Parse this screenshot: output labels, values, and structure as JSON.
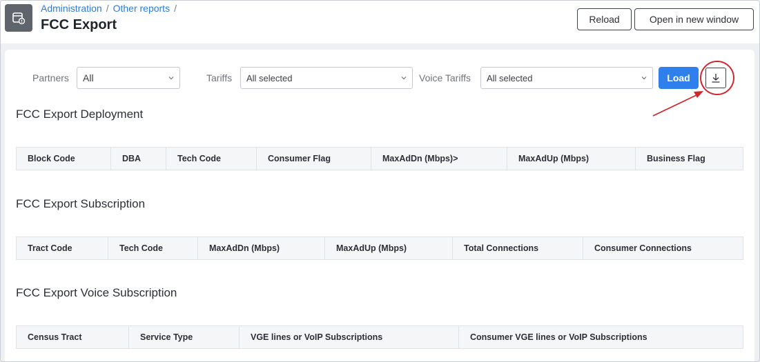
{
  "breadcrumb": {
    "items": [
      "Administration",
      "Other reports"
    ],
    "separator": "/"
  },
  "page_title": "FCC Export",
  "header_buttons": {
    "reload": "Reload",
    "open_new_window": "Open in new window"
  },
  "filters": {
    "partners": {
      "label": "Partners",
      "value": "All"
    },
    "tariffs": {
      "label": "Tariffs",
      "value": "All selected"
    },
    "voice_tariffs": {
      "label": "Voice Tariffs",
      "value": "All selected"
    },
    "load_label": "Load",
    "download_icon": "download-icon"
  },
  "sections": [
    {
      "title": "FCC Export Deployment",
      "columns": [
        "Block Code",
        "DBA",
        "Tech Code",
        "Consumer Flag",
        "MaxAdDn (Mbps)>",
        "MaxAdUp (Mbps)",
        "Business Flag"
      ]
    },
    {
      "title": "FCC Export Subscription",
      "columns": [
        "Tract Code",
        "Tech Code",
        "MaxAdDn (Mbps)",
        "MaxAdUp (Mbps)",
        "Total Connections",
        "Consumer Connections"
      ]
    },
    {
      "title": "FCC Export Voice Subscription",
      "columns": [
        "Census Tract",
        "Service Type",
        "VGE lines or VoIP Subscriptions",
        "Consumer VGE lines or VoIP Subscriptions"
      ]
    }
  ],
  "colors": {
    "accent": "#2f80ed",
    "annotation": "#d0252b",
    "link": "#2d7bd8"
  }
}
